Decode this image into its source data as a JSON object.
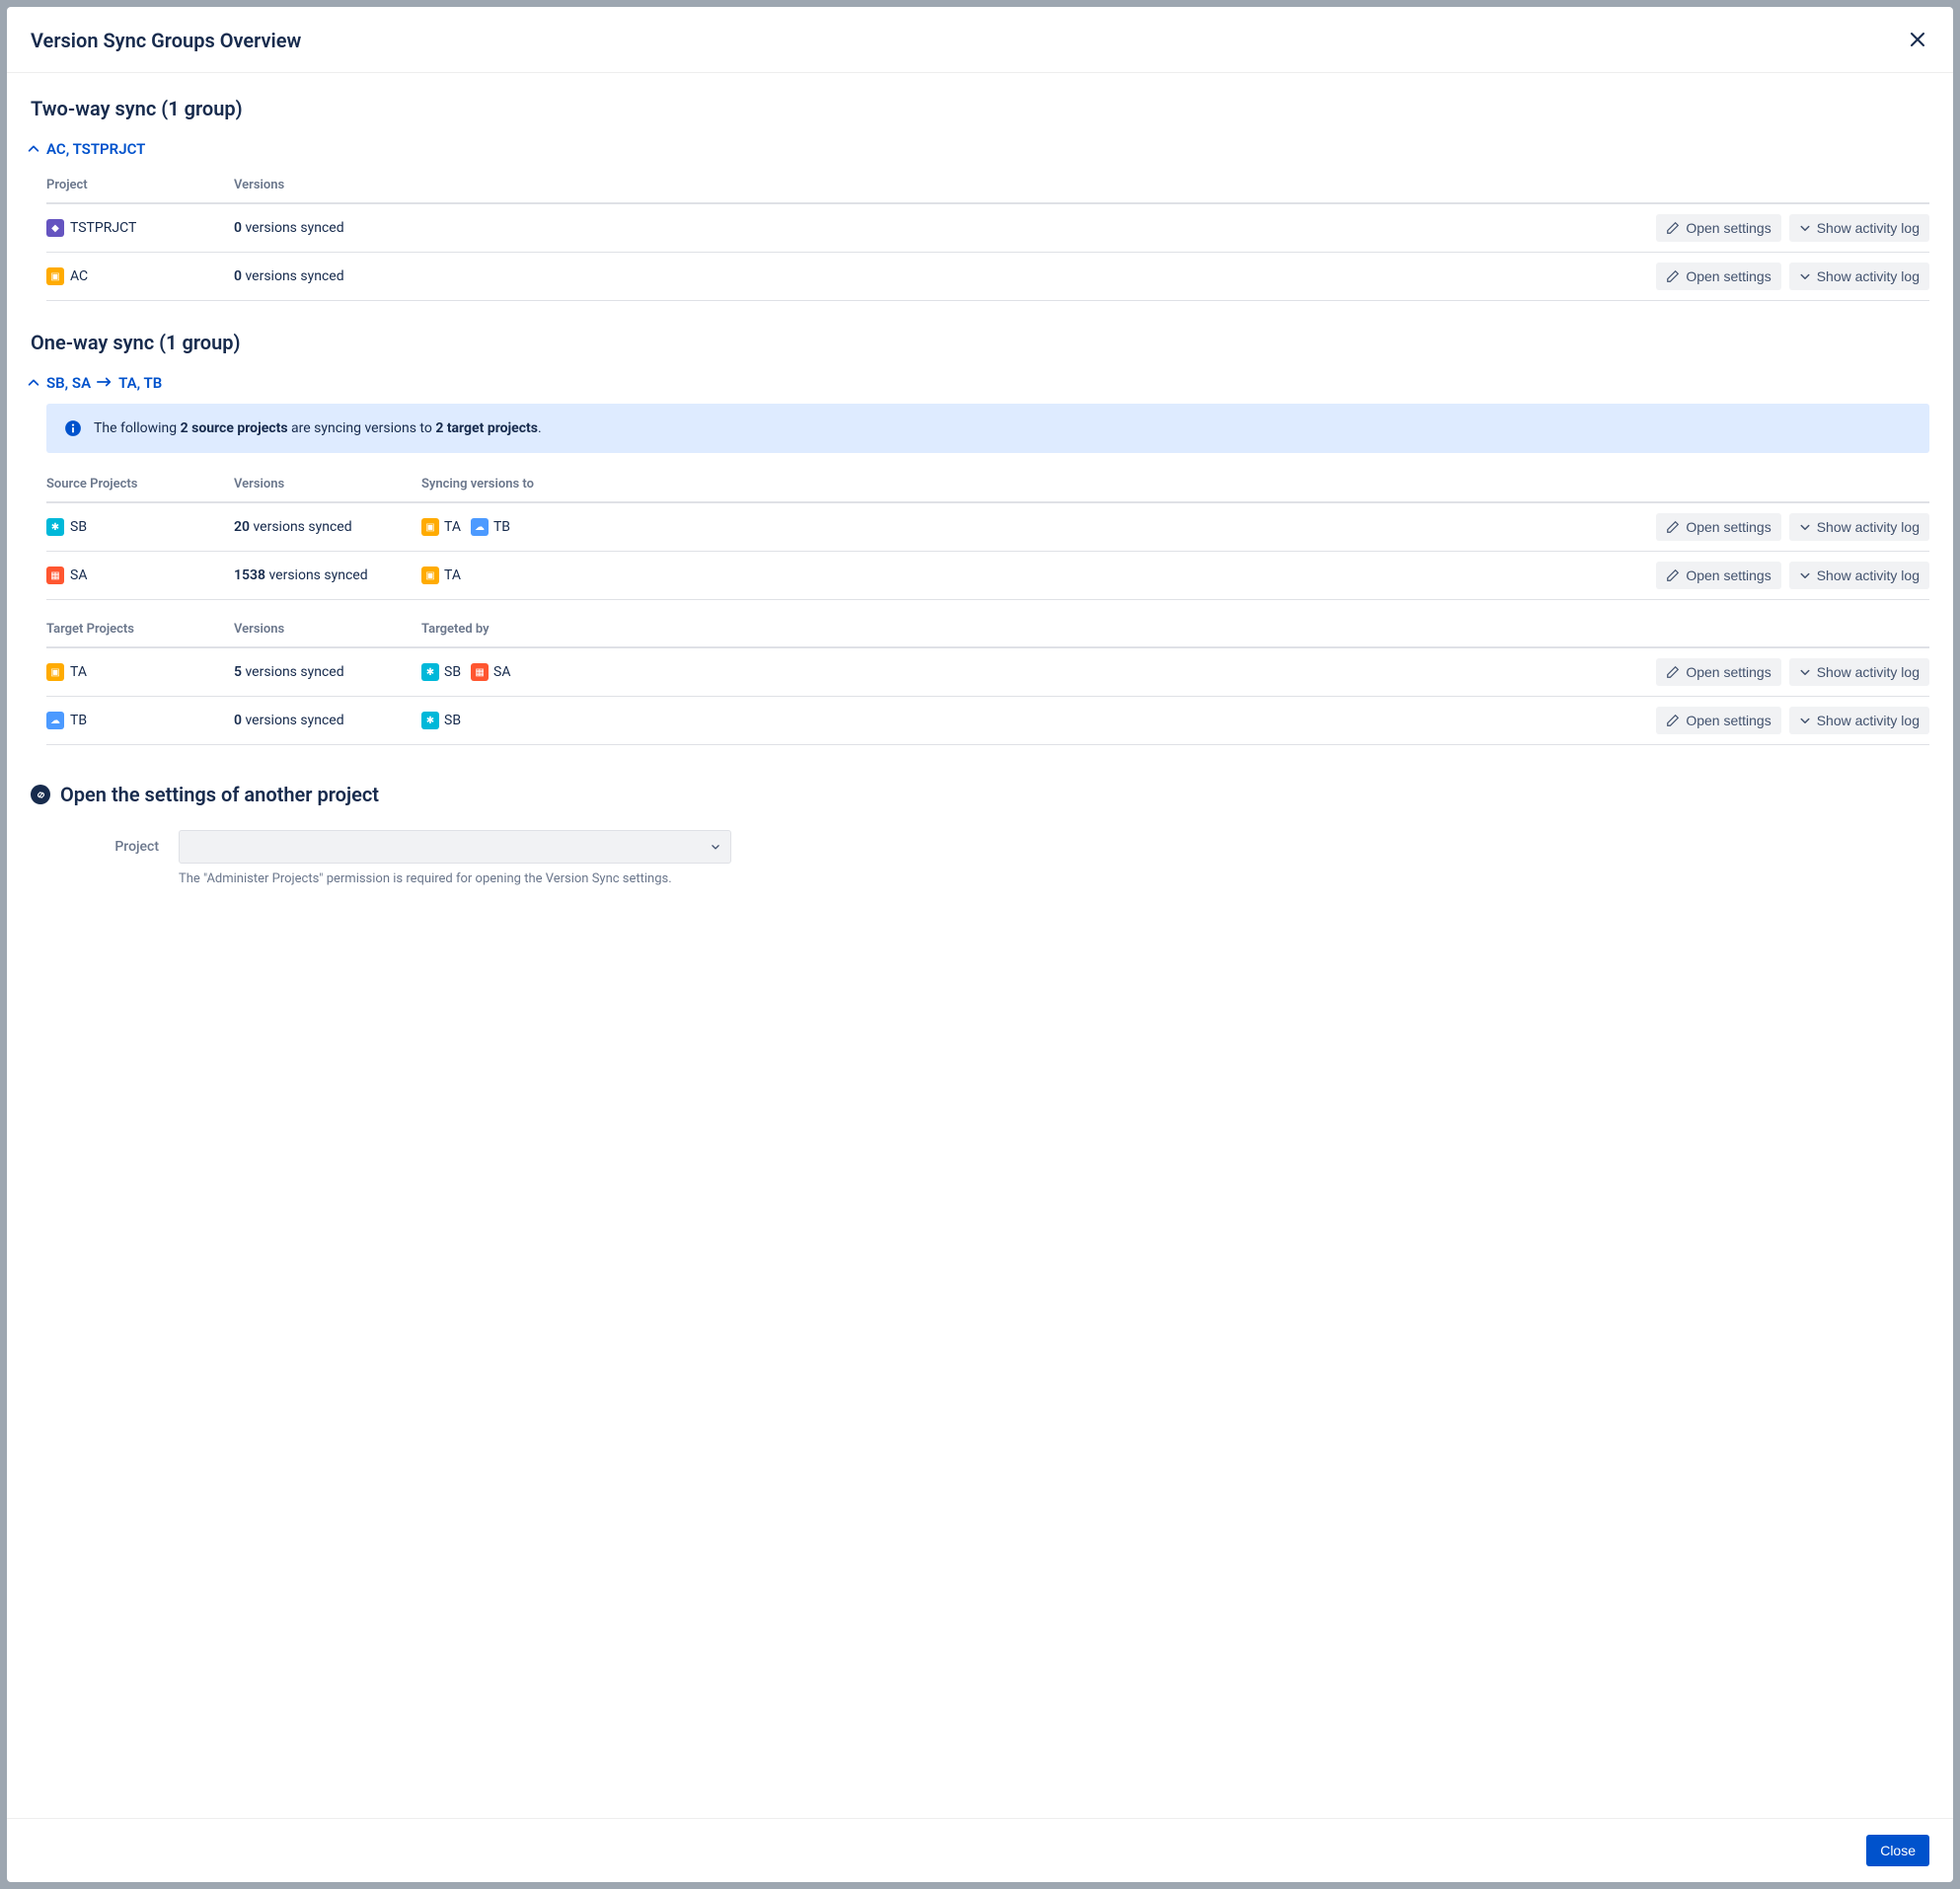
{
  "modal": {
    "title": "Version Sync Groups Overview",
    "close_button": "Close"
  },
  "two_way": {
    "title": "Two-way sync (1 group)",
    "group_label": "AC, TSTPRJCT",
    "headers": {
      "project": "Project",
      "versions": "Versions"
    },
    "rows": [
      {
        "name": "TSTPRJCT",
        "count": "0",
        "suffix": " versions synced"
      },
      {
        "name": "AC",
        "count": "0",
        "suffix": " versions synced"
      }
    ]
  },
  "one_way": {
    "title": "One-way sync (1 group)",
    "group_left": "SB, SA",
    "group_right": "TA, TB",
    "banner": {
      "pre": "The following ",
      "bold1": "2 source projects",
      "mid": " are syncing versions to ",
      "bold2": "2 target projects",
      "post": "."
    },
    "source_headers": {
      "project": "Source Projects",
      "versions": "Versions",
      "sync": "Syncing versions to"
    },
    "source_rows": [
      {
        "name": "SB",
        "count": "20",
        "suffix": " versions synced",
        "targets": [
          "TA",
          "TB"
        ]
      },
      {
        "name": "SA",
        "count": "1538",
        "suffix": " versions synced",
        "targets": [
          "TA"
        ]
      }
    ],
    "target_headers": {
      "project": "Target Projects",
      "versions": "Versions",
      "sync": "Targeted by"
    },
    "target_rows": [
      {
        "name": "TA",
        "count": "5",
        "suffix": " versions synced",
        "by": [
          "SB",
          "SA"
        ]
      },
      {
        "name": "TB",
        "count": "0",
        "suffix": " versions synced",
        "by": [
          "SB"
        ]
      }
    ]
  },
  "actions": {
    "open_settings": "Open settings",
    "show_log": "Show activity log"
  },
  "another": {
    "title": "Open the settings of another project",
    "label": "Project",
    "hint": "The \"Administer Projects\" permission is required for opening the Version Sync settings."
  }
}
